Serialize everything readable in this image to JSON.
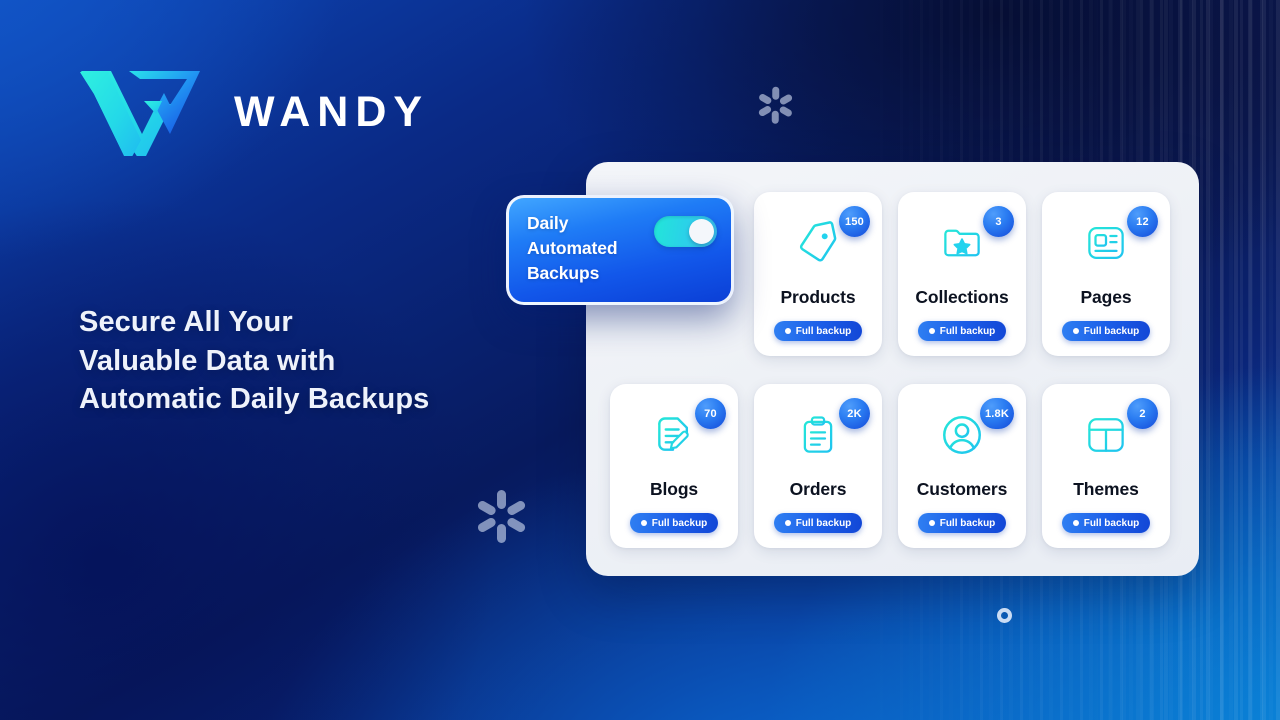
{
  "brand": {
    "name": "WANDY",
    "logo_icon": "wandy-w-logo"
  },
  "headline": {
    "line1": "Secure All Your",
    "line2": "Valuable Data with",
    "line3": "Automatic Daily Backups"
  },
  "toggle_card": {
    "label_line1": "Daily",
    "label_line2": "Automated",
    "label_line3": "Backups",
    "state": "on",
    "track_color": "#22e6d8",
    "card_color": "#1257ea"
  },
  "panel": {
    "cards": [
      {
        "title": "Products",
        "badge": "150",
        "status": "Full backup",
        "icon": "tag-icon"
      },
      {
        "title": "Collections",
        "badge": "3",
        "status": "Full backup",
        "icon": "folder-star-icon"
      },
      {
        "title": "Pages",
        "badge": "12",
        "status": "Full backup",
        "icon": "article-layout-icon"
      },
      {
        "title": "Blogs",
        "badge": "70",
        "status": "Full backup",
        "icon": "document-pencil-icon"
      },
      {
        "title": "Orders",
        "badge": "2K",
        "status": "Full backup",
        "icon": "clipboard-icon"
      },
      {
        "title": "Customers",
        "badge": "1.8K",
        "status": "Full backup",
        "icon": "user-circle-icon"
      },
      {
        "title": "Themes",
        "badge": "2",
        "status": "Full backup",
        "icon": "layout-grid-icon"
      }
    ]
  },
  "decor": {
    "sparkle_small": "sparkle-icon",
    "sparkle_large": "sparkle-icon",
    "ring": "ring-icon"
  },
  "colors": {
    "accent_cyan": "#22d3ee",
    "accent_blue": "#1b5de8",
    "badge_blue": "#2b7df2",
    "background_navy": "#071a5e"
  }
}
